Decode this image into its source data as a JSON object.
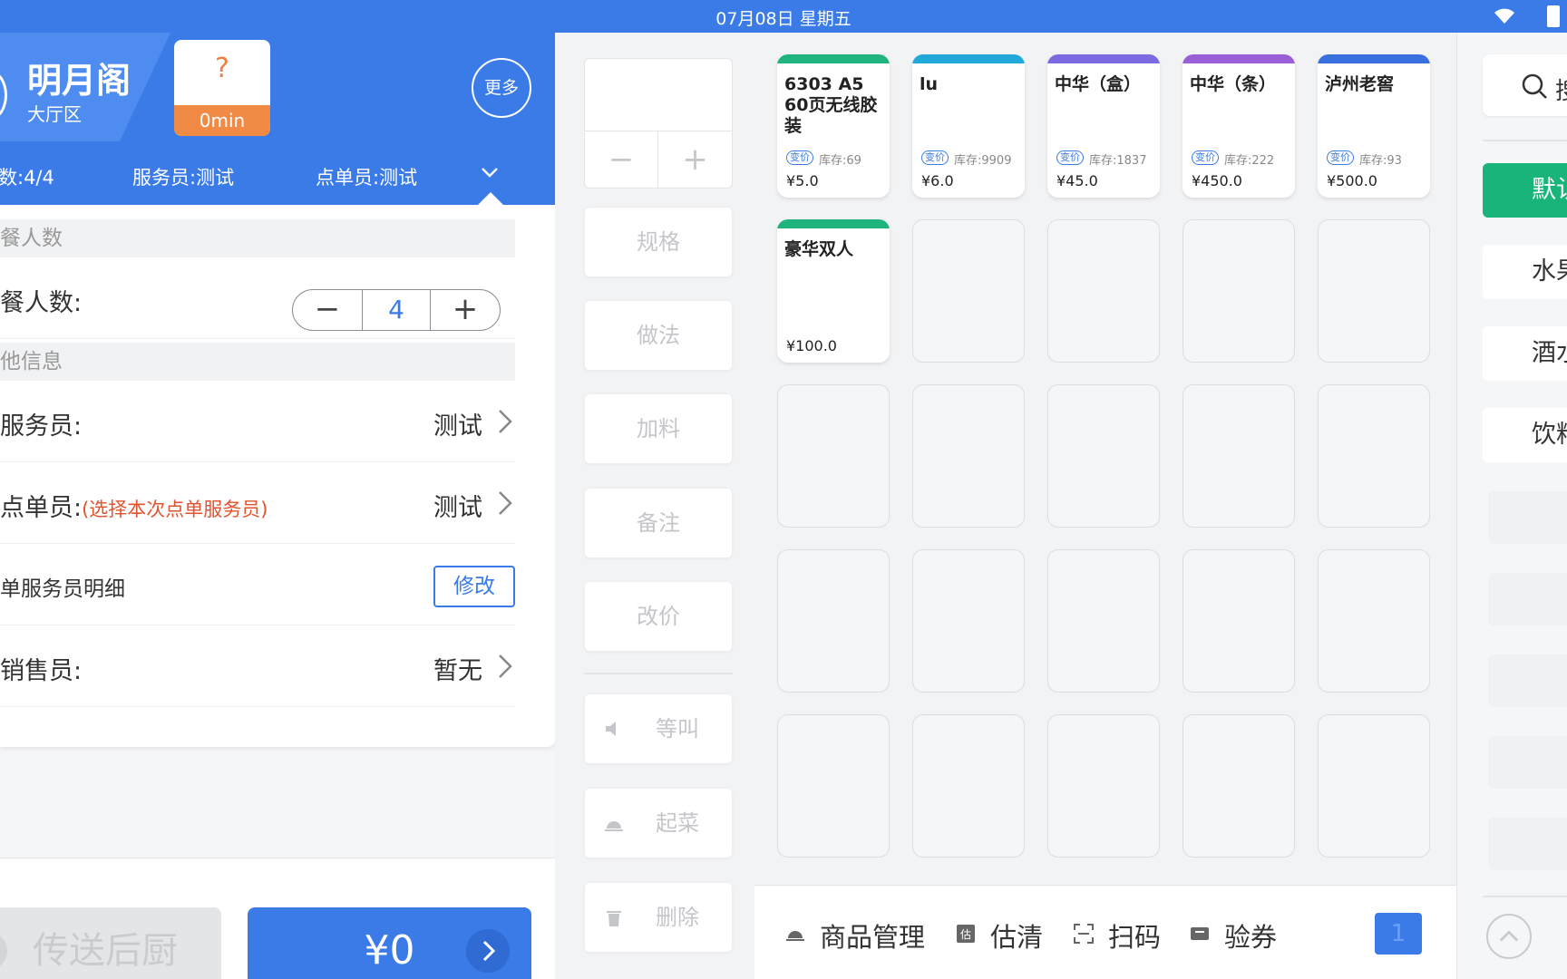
{
  "status_bar": {
    "date": "07月08日 星期五"
  },
  "order_header": {
    "table_name": "明月阁",
    "area": "大厅区",
    "timer_symbol": "?",
    "timer_value": "0min",
    "more_label": "更多",
    "guests_summary": "数:4/4",
    "waiter_summary": "服务员:测试",
    "orderer_summary": "点单员:测试"
  },
  "form": {
    "section_diners": "餐人数",
    "diners_label": "餐人数:",
    "diners_value": "4",
    "stepper_minus": "−",
    "stepper_plus": "+",
    "section_other": "他信息",
    "waiter_label": "服务员:",
    "waiter_value": "测试",
    "orderer_label": "点单员:",
    "orderer_hint": "(选择本次点单服务员)",
    "orderer_value": "测试",
    "detail_label": "单服务员明细",
    "modify_label": "修改",
    "sales_label": "销售员:",
    "sales_value": "暂无"
  },
  "footer": {
    "send_label": "传送后厨",
    "total": "¥0"
  },
  "actions": {
    "minus": "−",
    "plus": "+",
    "spec": "规格",
    "method": "做法",
    "addon": "加料",
    "remark": "备注",
    "reprice": "改价",
    "hold": "等叫",
    "serve": "起菜",
    "delete": "删除"
  },
  "products": [
    {
      "name": "6303 A5 60页无线胶装",
      "tag": "变价",
      "stock": "库存:69",
      "price": "¥5.0",
      "color": "#1fb47e"
    },
    {
      "name": "lu",
      "tag": "变价",
      "stock": "库存:9909",
      "price": "¥6.0",
      "color": "#20a8d8"
    },
    {
      "name": "中华（盒）",
      "tag": "变价",
      "stock": "库存:1837",
      "price": "¥45.0",
      "color": "#7a6be0"
    },
    {
      "name": "中华（条）",
      "tag": "变价",
      "stock": "库存:222",
      "price": "¥450.0",
      "color": "#9a5fd6"
    },
    {
      "name": "泸州老窖",
      "tag": "变价",
      "stock": "库存:93",
      "price": "¥500.0",
      "color": "#3a6fe0"
    },
    {
      "name": "豪华双人",
      "tag": "",
      "stock": "",
      "price": "¥100.0",
      "color": "#1fb47e"
    }
  ],
  "grid_toolbar": {
    "manage": "商品管理",
    "soldout": "估清",
    "scan": "扫码",
    "voucher": "验券",
    "page": "1"
  },
  "categories": {
    "search": "搜",
    "items": [
      "默认",
      "水果",
      "酒水饮",
      "饮料"
    ]
  }
}
